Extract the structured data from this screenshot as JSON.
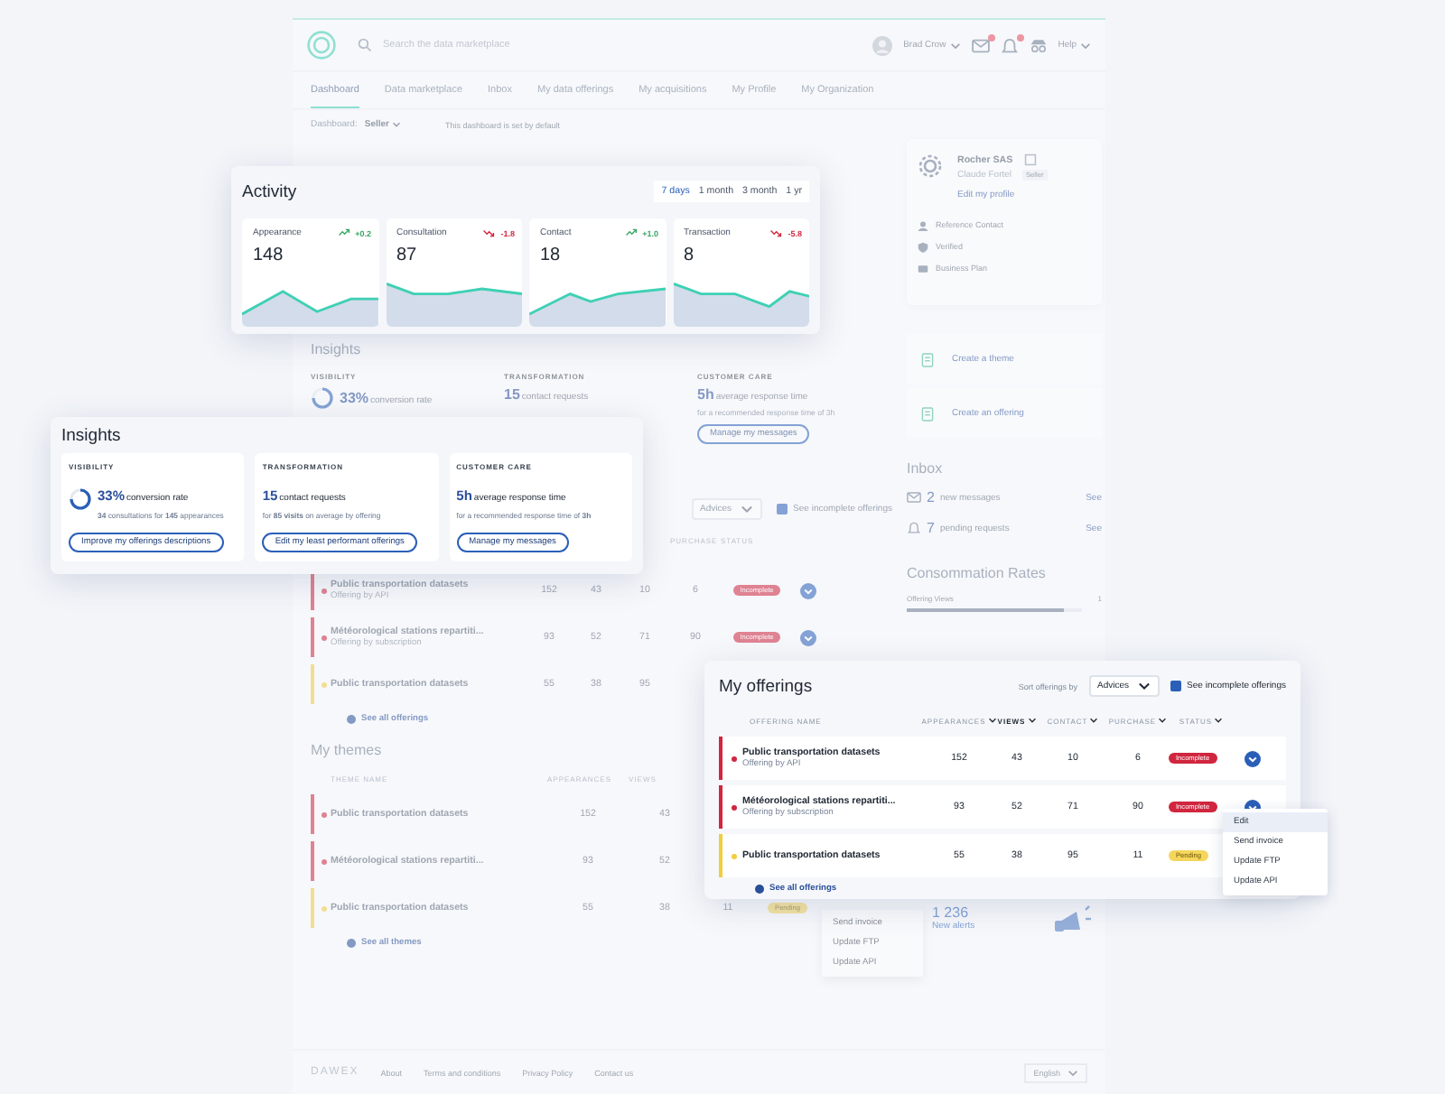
{
  "background": {
    "nav": {
      "search_placeholder": "Search the data marketplace",
      "user_name": "Brad Crow",
      "help": "Help"
    },
    "tabs": [
      {
        "label": "Dashboard",
        "selected": true
      },
      {
        "label": "Data marketplace",
        "selected": false
      },
      {
        "label": "Inbox",
        "selected": false
      },
      {
        "label": "My data offerings",
        "selected": false
      },
      {
        "label": "My acquisitions",
        "selected": false
      },
      {
        "label": "My Profile",
        "selected": false
      },
      {
        "label": "My Organization",
        "selected": false
      }
    ],
    "dashboard_selector": {
      "label": "Dashboard:",
      "value": "Seller"
    },
    "default_note": "This dashboard is set by default",
    "insights": {
      "title": "Insights",
      "items": [
        {
          "label": "VISIBILITY",
          "stat": "33%",
          "stat_text": "conversion rate"
        },
        {
          "label": "TRANSFORMATION",
          "stat": "15",
          "stat_text": "contact requests"
        },
        {
          "label": "CUSTOMER CARE",
          "stat": "5h",
          "stat_text": "average response time",
          "detail": "for a recommended response time of 3h",
          "action": "Manage my messages"
        }
      ]
    },
    "offerings": {
      "sort_value": "Advices",
      "incomplete": {
        "label": "See incomplete offerings",
        "checked": true
      },
      "visible_columns": {
        "purchase": "PURCHASE",
        "status": "STATUS"
      },
      "rows": [
        {
          "name": "Public transportation datasets",
          "subtitle": "Offering by API",
          "appearances": "152",
          "views": "43",
          "contact": "10",
          "purchase": "6",
          "status": "Incomplete",
          "kind": "incomplete"
        },
        {
          "name": "Météorological stations repartiti...",
          "subtitle": "Offering by subscription",
          "appearances": "93",
          "views": "52",
          "contact": "71",
          "purchase": "90",
          "status": "Incomplete",
          "kind": "incomplete"
        },
        {
          "name": "Public transportation datasets",
          "appearances": "55",
          "views": "38",
          "contact": "95",
          "kind": "pending"
        }
      ],
      "see_all": "See all offerings"
    },
    "themes": {
      "title": "My themes",
      "columns": [
        "THEME NAME",
        "APPEARANCES",
        "VIEWS"
      ],
      "rows": [
        {
          "name": "Public transportation datasets",
          "appearances": "152",
          "views": "43",
          "kind": "incomplete"
        },
        {
          "name": "Météorological stations repartiti...",
          "appearances": "93",
          "views": "52",
          "kind": "incomplete"
        },
        {
          "name": "Public transportation datasets",
          "appearances": "55",
          "views": "38",
          "purchase": "11",
          "status": "Pending",
          "kind": "pending"
        }
      ],
      "see_all": "See all themes"
    },
    "row_menu": [
      {
        "label": "Send invoice"
      },
      {
        "label": "Update FTP"
      },
      {
        "label": "Update API"
      }
    ],
    "profile": {
      "company": "Rocher SAS",
      "person": "Claude Fortel",
      "role": "Seller",
      "edit": "Edit my profile",
      "badges": [
        "Reference Contact",
        "Verified",
        "Business Plan"
      ]
    },
    "actions": [
      "Create a theme",
      "Create an offering"
    ],
    "inbox": {
      "title": "Inbox",
      "items": [
        {
          "count": "2",
          "text": "new messages",
          "link": "See"
        },
        {
          "count": "7",
          "text": "pending requests",
          "link": "See"
        }
      ]
    },
    "consumption": {
      "title": "Consommation Rates",
      "items": [
        {
          "label": "Offering Views",
          "value": "1",
          "level": 0.9
        }
      ]
    },
    "alerts": {
      "count": "1 236",
      "label": "New alerts"
    },
    "footer": {
      "logo": "DAWEX",
      "links": [
        "About",
        "Terms and conditions",
        "Privacy Policy",
        "Contact us"
      ],
      "language": "English"
    }
  },
  "activity": {
    "title": "Activity",
    "ranges": [
      {
        "label": "7 days",
        "selected": true
      },
      {
        "label": "1 month",
        "selected": false
      },
      {
        "label": "3 month",
        "selected": false
      },
      {
        "label": "1 yr",
        "selected": false
      }
    ],
    "metrics": [
      {
        "label": "Appearance",
        "value": "148",
        "change": "+0.2",
        "kind": "up"
      },
      {
        "label": "Consultation",
        "value": "87",
        "change": "-1.8",
        "kind": "down"
      },
      {
        "label": "Contact",
        "value": "18",
        "change": "+1.0",
        "kind": "up"
      },
      {
        "label": "Transaction",
        "value": "8",
        "change": "-5.8",
        "kind": "down"
      }
    ]
  },
  "insights": {
    "title": "Insights",
    "items": [
      {
        "label": "VISIBILITY",
        "stat": "33%",
        "stat_text": "conversion rate",
        "detail": "**34** consultations for **145** appearances",
        "action": "Improve my offerings descriptions"
      },
      {
        "label": "TRANSFORMATION",
        "stat": "15",
        "stat_text": "contact requests",
        "detail": "for **85 visits** on average by offering",
        "action": "Edit my least performant offerings"
      },
      {
        "label": "CUSTOMER CARE",
        "stat": "5h",
        "stat_text": "average response time",
        "detail": "for a recommended response time of **3h**",
        "action": "Manage my messages"
      }
    ]
  },
  "my_offerings": {
    "title": "My offerings",
    "sort_label": "Sort offerings by",
    "sort_value": "Advices",
    "incomplete": {
      "label": "See incomplete offerings",
      "checked": true
    },
    "columns": [
      {
        "label": "OFFERING NAME",
        "sorted": false
      },
      {
        "label": "APPEARANCES",
        "sorted": false
      },
      {
        "label": "VIEWS",
        "sorted": true
      },
      {
        "label": "CONTACT",
        "sorted": false
      },
      {
        "label": "PURCHASE",
        "sorted": false
      },
      {
        "label": "STATUS",
        "sorted": false
      }
    ],
    "rows": [
      {
        "name": "Public transportation datasets",
        "subtitle": "Offering by API",
        "appearances": "152",
        "views": "43",
        "contact": "10",
        "purchase": "6",
        "status": "Incomplete",
        "kind": "incomplete"
      },
      {
        "name": "Météorological stations repartiti...",
        "subtitle": "Offering by subscription",
        "appearances": "93",
        "views": "52",
        "contact": "71",
        "purchase": "90",
        "status": "Incomplete",
        "kind": "incomplete"
      },
      {
        "name": "Public transportation datasets",
        "appearances": "55",
        "views": "38",
        "contact": "95",
        "purchase": "11",
        "status": "Pending",
        "kind": "pending"
      }
    ],
    "see_all": "See all offerings",
    "row_menu": [
      {
        "label": "Edit",
        "selected": true
      },
      {
        "label": "Send invoice",
        "selected": false
      },
      {
        "label": "Update FTP",
        "selected": false
      },
      {
        "label": "Update API",
        "selected": false
      }
    ]
  }
}
